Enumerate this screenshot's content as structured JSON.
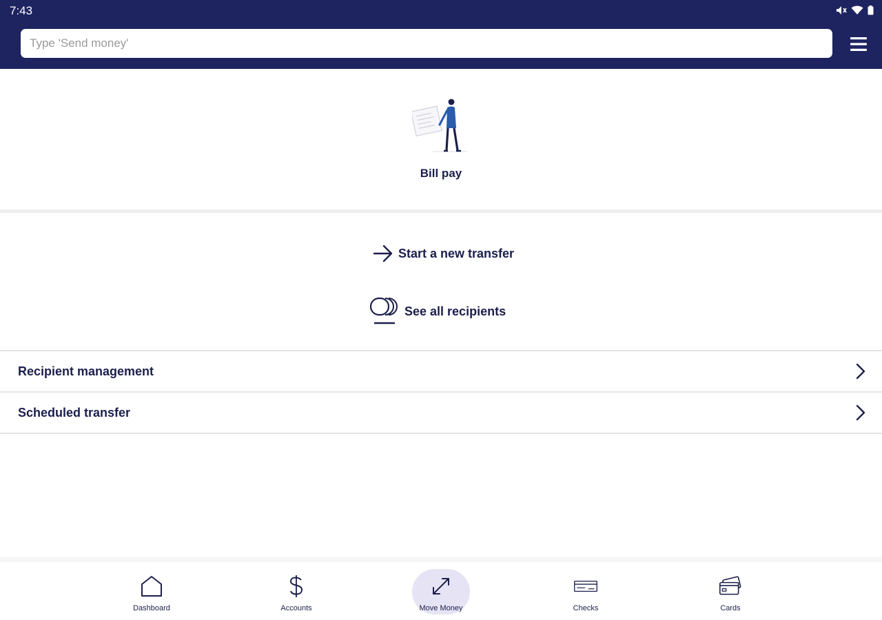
{
  "status_bar": {
    "time": "7:43"
  },
  "search": {
    "placeholder": "Type 'Send money'"
  },
  "bill_pay": {
    "label": "Bill pay"
  },
  "actions": {
    "new_transfer": "Start a new transfer",
    "see_recipients": "See all recipients"
  },
  "list": [
    {
      "label": "Recipient management"
    },
    {
      "label": "Scheduled transfer"
    }
  ],
  "bottom_nav": [
    {
      "label": "Dashboard",
      "icon": "home-icon"
    },
    {
      "label": "Accounts",
      "icon": "dollar-icon"
    },
    {
      "label": "Move Money",
      "icon": "transfer-arrows-icon",
      "active": true
    },
    {
      "label": "Checks",
      "icon": "check-icon"
    },
    {
      "label": "Cards",
      "icon": "cards-icon"
    }
  ],
  "colors": {
    "header_bg": "#1e2460",
    "text_primary": "#1b1f4b",
    "active_tab_bg": "#e6e3f5",
    "divider": "#e3e4e8"
  }
}
